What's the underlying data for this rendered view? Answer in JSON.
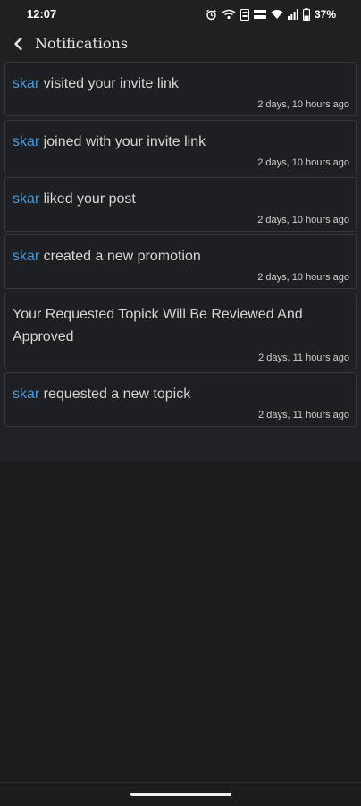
{
  "status_bar": {
    "time": "12:07",
    "icons": [
      "alarm-icon",
      "wifi-calling-icon",
      "volte-icon",
      "data-rate-icon",
      "wifi-icon",
      "signal-icon",
      "battery-icon"
    ],
    "battery": "37%"
  },
  "header": {
    "title": "Notifications"
  },
  "notifications": [
    {
      "user": "skar",
      "text": " visited your invite link",
      "time": "2 days, 10 hours ago"
    },
    {
      "user": "skar",
      "text": " joined with your invite link",
      "time": "2 days, 10 hours ago"
    },
    {
      "user": "skar",
      "text": " liked your post",
      "time": "2 days, 10 hours ago"
    },
    {
      "user": "skar",
      "text": " created a new promotion",
      "time": "2 days, 10 hours ago"
    },
    {
      "user": "",
      "text": "Your Requested Topick Will Be Reviewed And Approved",
      "time": "2 days, 11 hours ago"
    },
    {
      "user": "skar",
      "text": " requested a new topick",
      "time": "2 days, 11 hours ago"
    }
  ],
  "colors": {
    "background": "#1b1c1e",
    "card": "#1e1f22",
    "link": "#4b9be2",
    "text": "#d6d6d6"
  }
}
